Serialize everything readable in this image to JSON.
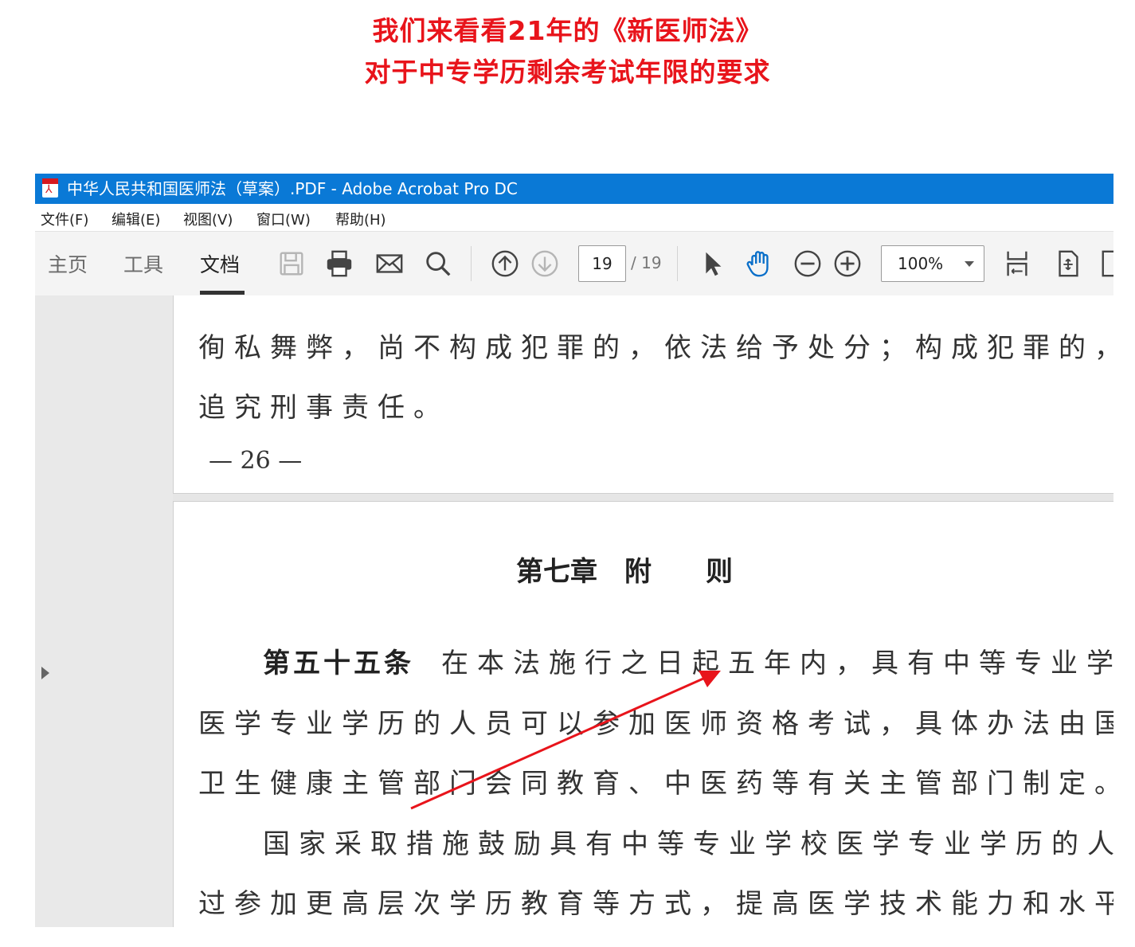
{
  "headline": {
    "line1": "我们来看看21年的《新医师法》",
    "line2": "对于中专学历剩余考试年限的要求"
  },
  "window": {
    "title": "中华人民共和国医师法（草案）.PDF - Adobe Acrobat Pro DC",
    "app_icon": "pdf-icon"
  },
  "menu": {
    "items": [
      "文件(F)",
      "编辑(E)",
      "视图(V)",
      "窗口(W)",
      "帮助(H)"
    ]
  },
  "toolbar": {
    "tabs": [
      "主页",
      "工具",
      "文档"
    ],
    "active_tab": "文档",
    "icons": [
      "save-icon",
      "print-icon",
      "email-icon",
      "search-icon",
      "page-up-icon",
      "page-down-icon",
      "select-cursor-icon",
      "hand-tool-icon",
      "zoom-out-icon",
      "zoom-in-icon",
      "fit-page-icon",
      "rotate-page-icon"
    ],
    "page_current": "19",
    "page_total": "/ 19",
    "zoom": "100%",
    "accent_color": "#0a79d6"
  },
  "document": {
    "page1": {
      "lines": [
        "徇私舞弊，尚不构成犯罪的，依法给予处分；构成犯罪的，依法",
        "追究刑事责任。"
      ],
      "page_number": "—  26  —"
    },
    "page2": {
      "chapter_title": "第七章　附　　则",
      "article_title": "第五十五条",
      "article_line1_rest": "在本法施行之日起五年内，具有中等专业学校",
      "lines": [
        "医学专业学历的人员可以参加医师资格考试，具体办法由国务院",
        "卫生健康主管部门会同教育、中医药等有关主管部门制定。",
        "国家采取措施鼓励具有中等专业学校医学专业学历的人员通",
        "过参加更高层次学历教育等方式，提高医学技术能力和水平。"
      ]
    }
  },
  "annotation": {
    "arrow_color": "#e8141b"
  }
}
